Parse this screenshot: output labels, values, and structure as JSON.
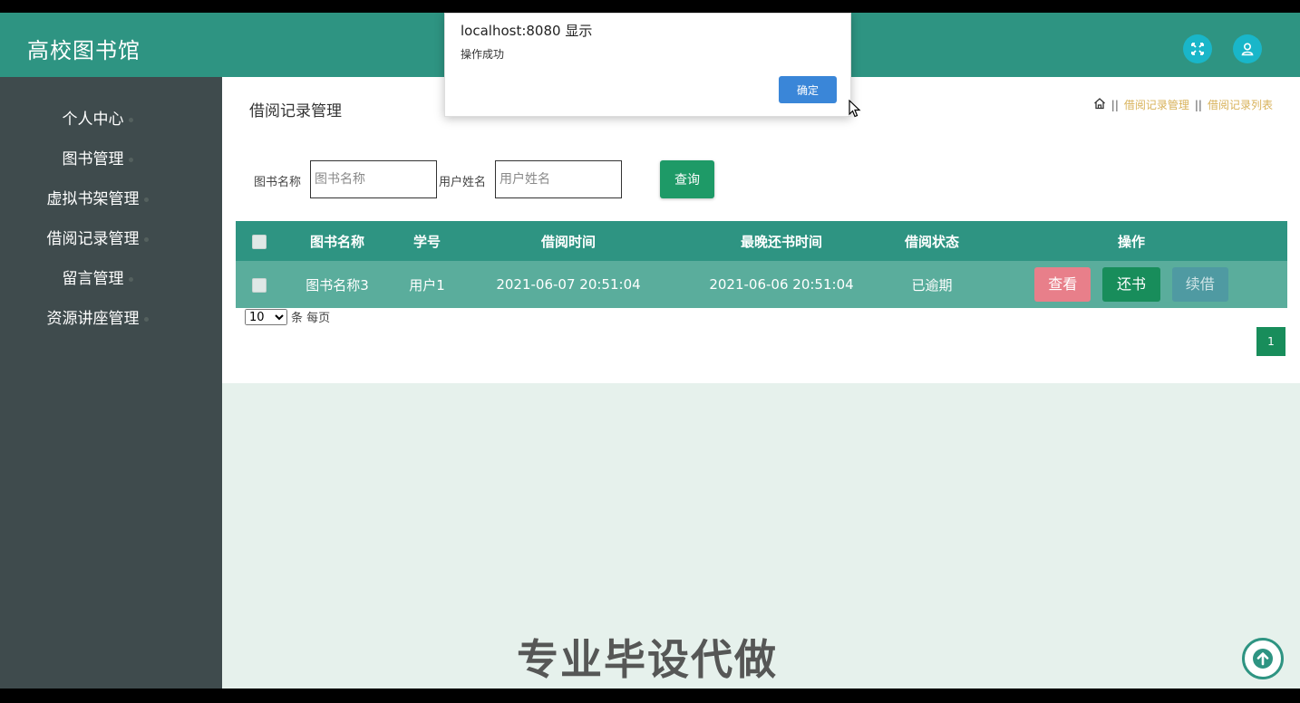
{
  "app": {
    "title": "高校图书馆"
  },
  "sidebar": {
    "items": [
      {
        "label": "个人中心"
      },
      {
        "label": "图书管理"
      },
      {
        "label": "虚拟书架管理"
      },
      {
        "label": "借阅记录管理"
      },
      {
        "label": "留言管理"
      },
      {
        "label": "资源讲座管理"
      }
    ]
  },
  "page": {
    "title": "借阅记录管理",
    "breadcrumb": {
      "home_icon": "home-icon",
      "sep": "||",
      "link1": "借阅记录管理",
      "link2": "借阅记录列表"
    }
  },
  "search": {
    "book_label": "图书名称",
    "book_placeholder": "图书名称",
    "user_label": "用户姓名",
    "user_placeholder": "用户姓名",
    "query_label": "查询"
  },
  "table": {
    "headers": [
      "图书名称",
      "学号",
      "借阅时间",
      "最晚还书时间",
      "借阅状态",
      "操作"
    ],
    "rows": [
      {
        "book": "图书名称3",
        "student_no": "用户1",
        "borrow_time": "2021-06-07 20:51:04",
        "due_time": "2021-06-06 20:51:04",
        "status": "已逾期"
      }
    ],
    "actions": {
      "view": "查看",
      "return": "还书",
      "renew": "续借"
    }
  },
  "pagination": {
    "page_size": "10",
    "page_size_suffix": "条 每页",
    "current_page": "1"
  },
  "dialog": {
    "title": "localhost:8080 显示",
    "message": "操作成功",
    "ok_label": "确定"
  },
  "watermark": "专业毕设代做",
  "colors": {
    "header": "#2e9482",
    "sidebar": "#3f4b4d",
    "row": "#5aad9c",
    "primary": "#188d5b",
    "danger": "#e87f8a",
    "accent": "#19b6c9"
  }
}
